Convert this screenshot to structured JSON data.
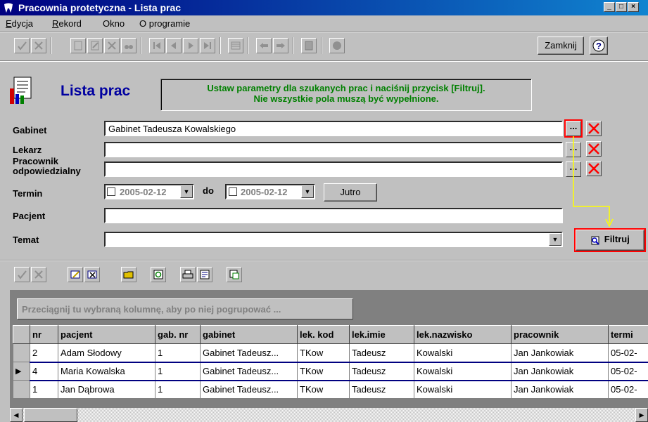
{
  "window": {
    "title": "Pracownia protetyczna - Lista prac"
  },
  "menu": [
    "Edycja",
    "Rekord",
    "Okno",
    "O programie"
  ],
  "menu_underline": [
    "E",
    "R",
    "",
    ""
  ],
  "toolbar": {
    "close_label": "Zamknij",
    "help_label": "?"
  },
  "header": {
    "title": "Lista prac",
    "hint_line1": "Ustaw parametry dla szukanych prac i naciśnij przycisk [Filtruj].",
    "hint_line2": "Nie wszystkie pola muszą być wypełnione."
  },
  "form": {
    "gabinet_label": "Gabinet",
    "gabinet_value": "Gabinet Tadeusza Kowalskiego",
    "lekarz_label": "Lekarz",
    "pracownik_label_line1": "Pracownik",
    "pracownik_label_line2": "odpowiedzialny",
    "termin_label": "Termin",
    "date_from": "2005-02-12",
    "do_label": "do",
    "date_to": "2005-02-12",
    "jutro_label": "Jutro",
    "pacjent_label": "Pacjent",
    "temat_label": "Temat",
    "filtruj_label": "Filtruj",
    "dots": "..."
  },
  "grid": {
    "group_hint": "Przeciągnij tu wybraną kolumnę, aby po niej pogrupować ...",
    "columns": [
      "nr",
      "pacjent",
      "gab. nr",
      "gabinet",
      "lek. kod",
      "lek.imie",
      "lek.nazwisko",
      "pracownik",
      "termi"
    ],
    "rows": [
      [
        "2",
        "Adam Słodowy",
        "1",
        "Gabinet Tadeusz...",
        "TKow",
        "Tadeusz",
        "Kowalski",
        "Jan Jankowiak",
        "05-02-"
      ],
      [
        "4",
        "Maria Kowalska",
        "1",
        "Gabinet Tadeusz...",
        "TKow",
        "Tadeusz",
        "Kowalski",
        "Jan Jankowiak",
        "05-02-"
      ],
      [
        "1",
        "Jan Dąbrowa",
        "1",
        "Gabinet Tadeusz...",
        "TKow",
        "Tadeusz",
        "Kowalski",
        "Jan Jankowiak",
        "05-02-"
      ]
    ],
    "current_row": 1
  },
  "colors": {
    "hint_text": "#008000",
    "title_text": "#0000a0",
    "highlight": "#ff0000",
    "arrow": "#ffff00"
  }
}
